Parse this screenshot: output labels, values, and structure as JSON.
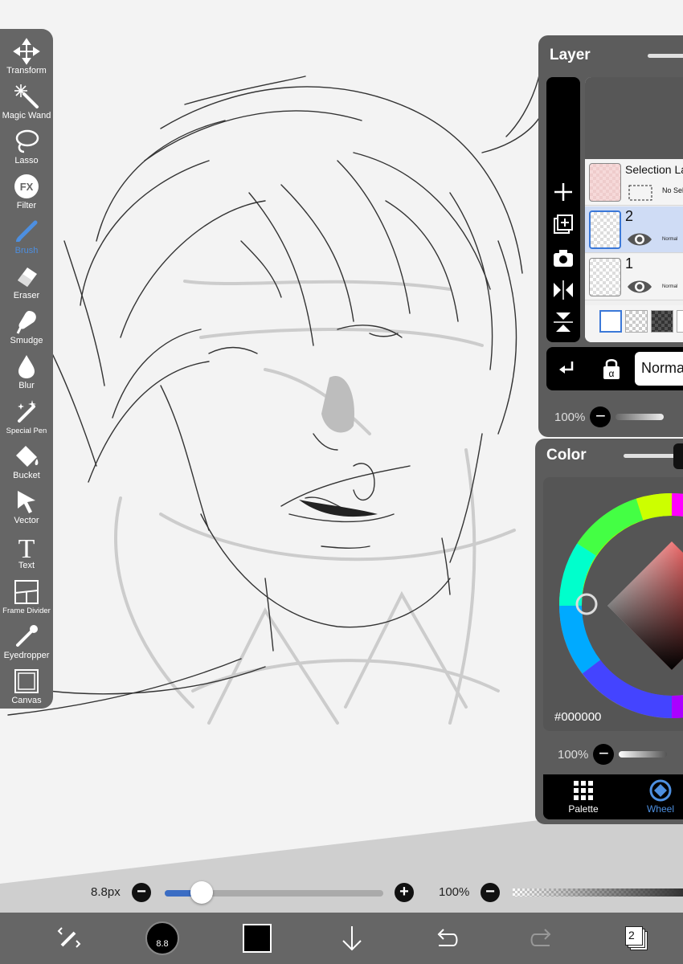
{
  "tools": [
    {
      "name": "transform",
      "label": "Transform",
      "icon": "move-arrows-icon"
    },
    {
      "name": "magic-wand",
      "label": "Magic Wand",
      "icon": "magic-wand-icon"
    },
    {
      "name": "lasso",
      "label": "Lasso",
      "icon": "lasso-icon"
    },
    {
      "name": "filter",
      "label": "Filter",
      "icon": "fx-icon"
    },
    {
      "name": "brush",
      "label": "Brush",
      "icon": "brush-icon",
      "active": true
    },
    {
      "name": "eraser",
      "label": "Eraser",
      "icon": "eraser-icon"
    },
    {
      "name": "smudge",
      "label": "Smudge",
      "icon": "smudge-icon"
    },
    {
      "name": "blur",
      "label": "Blur",
      "icon": "drop-icon"
    },
    {
      "name": "special-pen",
      "label": "Special Pen",
      "icon": "sparkle-pen-icon"
    },
    {
      "name": "bucket",
      "label": "Bucket",
      "icon": "bucket-icon"
    },
    {
      "name": "vector",
      "label": "Vector",
      "icon": "cursor-arrow-icon"
    },
    {
      "name": "text",
      "label": "Text",
      "icon": "text-t-icon"
    },
    {
      "name": "frame-divider",
      "label": "Frame Divider",
      "icon": "frame-divider-icon"
    },
    {
      "name": "eyedropper",
      "label": "Eyedropper",
      "icon": "eyedropper-icon"
    },
    {
      "name": "canvas",
      "label": "Canvas",
      "icon": "canvas-square-icon"
    }
  ],
  "layer_panel": {
    "title": "Layer",
    "layers": [
      {
        "name": "Selection La",
        "sub": "No Sel",
        "type": "selection"
      },
      {
        "name": "2",
        "mode": "Normal",
        "selected": true
      },
      {
        "name": "1",
        "mode": "Normal",
        "selected": false
      }
    ],
    "blend_mode": "Norma",
    "opacity": "100%"
  },
  "color_panel": {
    "title": "Color",
    "hex": "#000000",
    "opacity": "100%",
    "tabs": [
      {
        "label": "Palette",
        "icon": "grid-icon",
        "active": false
      },
      {
        "label": "Wheel",
        "icon": "wheel-diamond-icon",
        "active": true
      }
    ]
  },
  "brush_bar": {
    "size_label": "8.8px",
    "size_fraction": 0.17,
    "opacity_label": "100%"
  },
  "bottom_bar": {
    "brush_size": "8.8",
    "current_color": "#000000",
    "layer_count": "2"
  },
  "colors": {
    "accent": "#3b78d8",
    "panel": "#5c5c5c",
    "toolbar": "#666666"
  }
}
